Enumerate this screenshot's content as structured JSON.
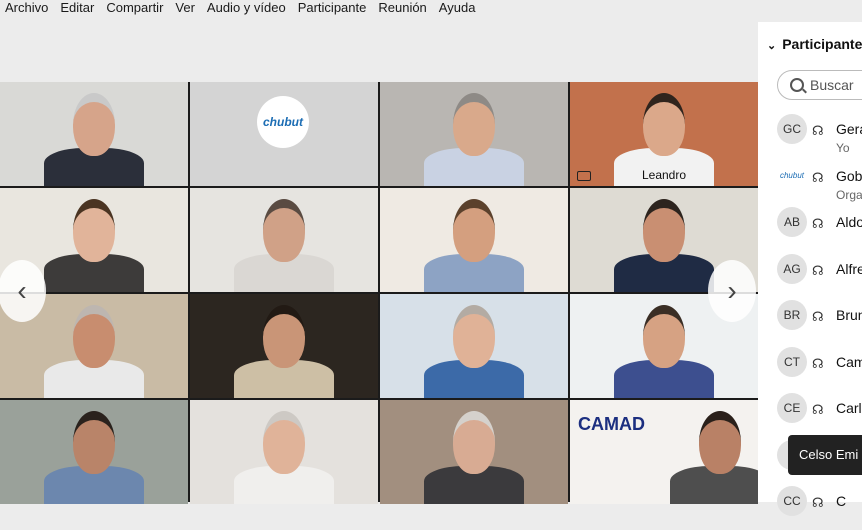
{
  "menu": [
    "Archivo",
    "Editar",
    "Compartir",
    "Ver",
    "Audio y vídeo",
    "Participante",
    "Reunión",
    "Ayuda"
  ],
  "grid": {
    "tiles": [
      {
        "bg": "#d9d9d6",
        "shirt": "#2b2f3a",
        "skin": "#d6a48a",
        "hair": "#c9c9c9"
      },
      {
        "logo": "chubut"
      },
      {
        "bg": "#b9b6b2",
        "shirt": "#c9d2e3",
        "skin": "#d9a98b",
        "hair": "#8e8a86"
      },
      {
        "bg": "#c2714c",
        "shirt": "#f2f2f2",
        "skin": "#dba88a",
        "hair": "#2f241d",
        "name": "Leandro",
        "active": true
      },
      {
        "bg": "#e9e6df",
        "shirt": "#3d3b3a",
        "skin": "#e1b49a",
        "hair": "#4a3422"
      },
      {
        "bg": "#e6e4e0",
        "shirt": "#dad7d3",
        "skin": "#d0a187",
        "hair": "#5a4b42"
      },
      {
        "bg": "#efeae3",
        "shirt": "#8da3c4",
        "skin": "#d49f7f",
        "hair": "#5b412c"
      },
      {
        "bg": "#dedbd3",
        "shirt": "#1f2b44",
        "skin": "#c98f72",
        "hair": "#2d241e"
      },
      {
        "bg": "#c9bba5",
        "shirt": "#e9e9e9",
        "skin": "#c88d6f",
        "hair": "#bdb6b0"
      },
      {
        "bg": "#2c2620",
        "shirt": "#cdbfa5",
        "skin": "#c99577",
        "hair": "#221a14"
      },
      {
        "bg": "#d7e0e8",
        "shirt": "#3c6aa8",
        "skin": "#e0b297",
        "hair": "#b3aba3"
      },
      {
        "bg": "#eef1f2",
        "shirt": "#3d4f8f",
        "skin": "#d6a283",
        "hair": "#3a2e25"
      },
      {
        "bg": "#9aa19a",
        "shirt": "#6c87ae",
        "skin": "#b98469",
        "hair": "#2a221d"
      },
      {
        "bg": "#e4e1dd",
        "shirt": "#f0efed",
        "skin": "#e0b399",
        "hair": "#cdc9c4"
      },
      {
        "bg": "#a28f7f",
        "shirt": "#3b3a3d",
        "skin": "#d8ab93",
        "hair": "#d5d1cc"
      },
      {
        "logo": "camad",
        "bg": "#f4f2ef",
        "shirt": "#4e4e4e",
        "skin": "#b98166",
        "hair": "#2a201a"
      }
    ],
    "logo_text": "chubut",
    "camad_text": "CAMAD"
  },
  "panel": {
    "header": "Participante",
    "search_placeholder": "Buscar",
    "participants": [
      {
        "initials": "GC",
        "name": "Gera",
        "sub": "Yo"
      },
      {
        "initials": "chubut",
        "name": "Gob",
        "sub": "Orga"
      },
      {
        "initials": "AB",
        "name": "Aldo"
      },
      {
        "initials": "AG",
        "name": "Alfre"
      },
      {
        "initials": "BR",
        "name": "Brun"
      },
      {
        "initials": "CT",
        "name": "Cam"
      },
      {
        "initials": "CE",
        "name": "Carl"
      },
      {
        "initials": "C",
        "name": ""
      },
      {
        "initials": "CC",
        "name": "C"
      }
    ]
  },
  "tooltip": "Celso Emi",
  "colors": {
    "active_border": "#2ec4e6",
    "brand": "#1c6db4"
  }
}
